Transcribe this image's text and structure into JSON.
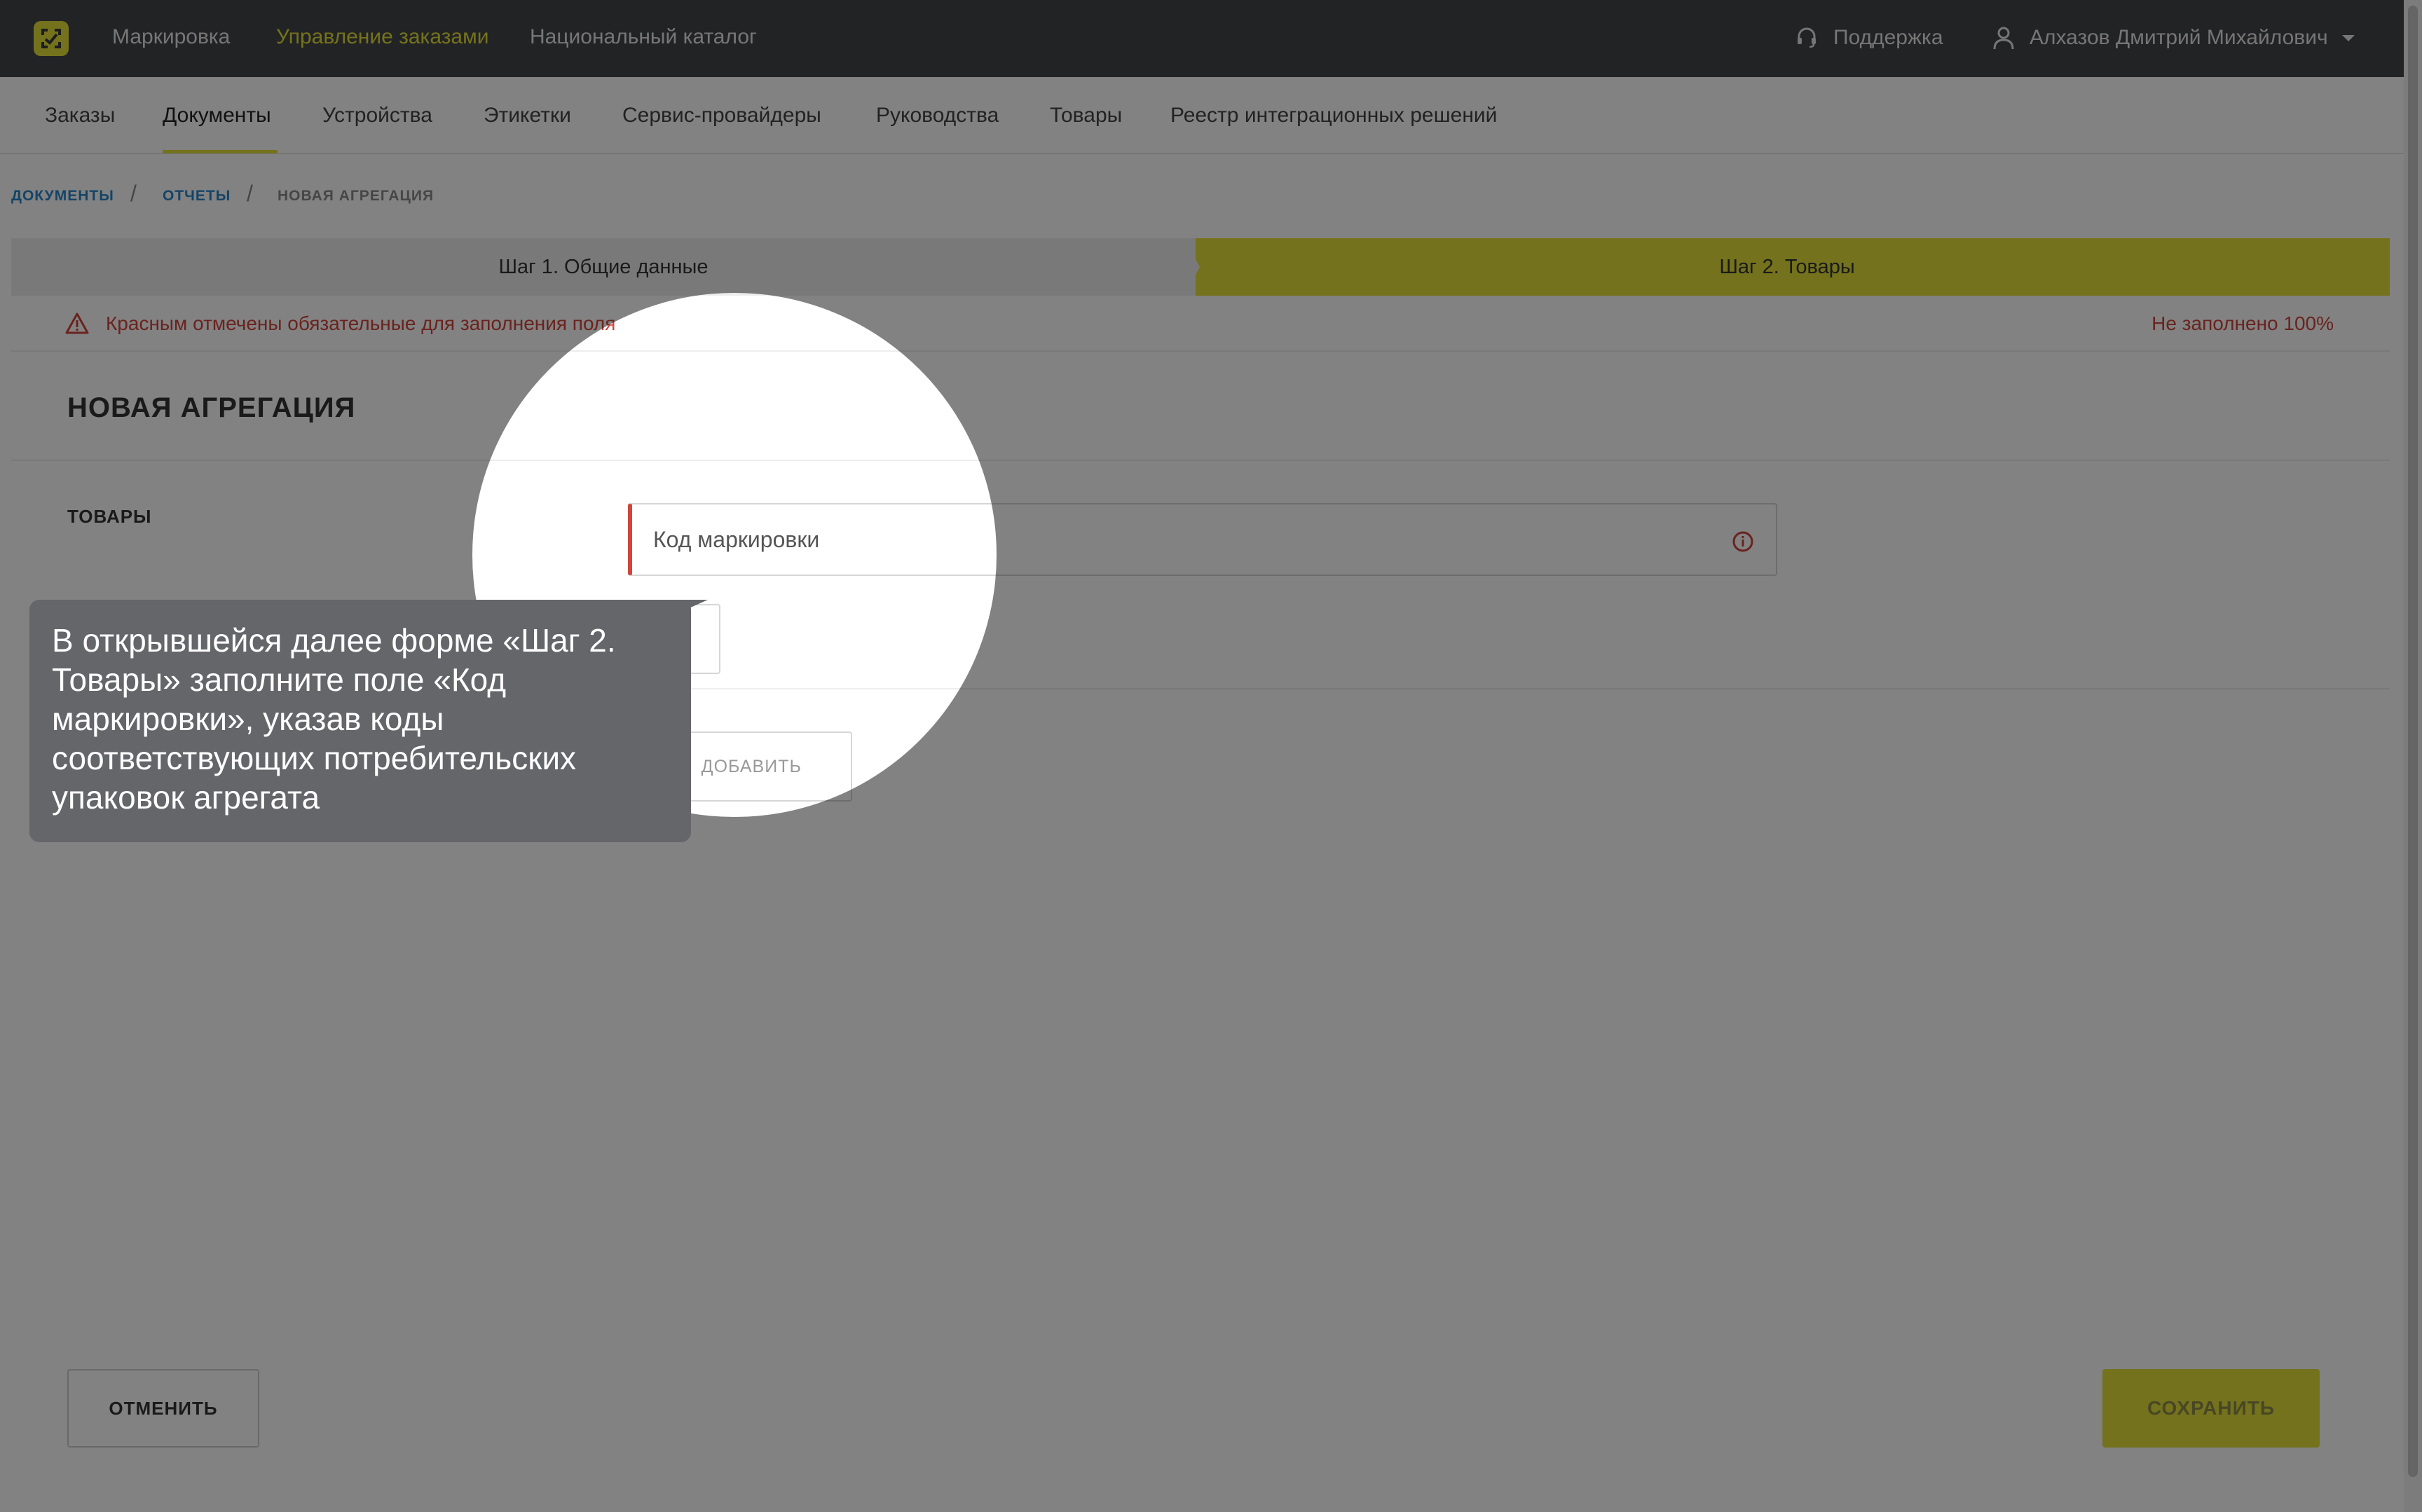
{
  "header": {
    "nav": [
      "Маркировка",
      "Управление заказами",
      "Национальный каталог"
    ],
    "active_nav": "Управление заказами",
    "support_label": "Поддержка",
    "user_name": "Алхазов Дмитрий Михайлович",
    "accent_color": "#e4e03a"
  },
  "subnav": {
    "items": [
      "Заказы",
      "Документы",
      "Устройства",
      "Этикетки",
      "Сервис-провайдеры",
      "Руководства",
      "Товары",
      "Реестр интеграционных решений"
    ],
    "active": "Документы"
  },
  "breadcrumb": {
    "items": [
      "ДОКУМЕНТЫ",
      "ОТЧЕТЫ",
      "НОВАЯ АГРЕГАЦИЯ"
    ],
    "separator": "/"
  },
  "steps": {
    "step1": "Шаг 1. Общие данные",
    "step2": "Шаг 2. Товары",
    "active": "Шаг 2. Товары"
  },
  "notice": {
    "required_text": "Красным отмечены обязательные для заполнения поля",
    "progress_text": "Не заполнено 100%",
    "color": "#d0453c"
  },
  "form": {
    "title": "НОВАЯ АГРЕГАЦИЯ",
    "section_label": "ТОВАРЫ",
    "marking_code_label": "Код маркировки",
    "add_button": "ДОБАВИТЬ"
  },
  "footer": {
    "cancel": "ОТМЕНИТЬ",
    "save": "СОХРАНИТЬ"
  },
  "tooltip": {
    "text": "В открывшейся далее форме «Шаг 2. Товары» заполните поле «Код маркировки», указав коды соответствующих потребительских упаковок агрегата"
  },
  "icons": {
    "logo": "app-logo-icon",
    "support": "headset-icon",
    "user": "user-icon",
    "dropdown": "chevron-down-icon",
    "warning": "warning-triangle-icon",
    "field_error": "info-circle-icon",
    "add": "plus-icon"
  }
}
